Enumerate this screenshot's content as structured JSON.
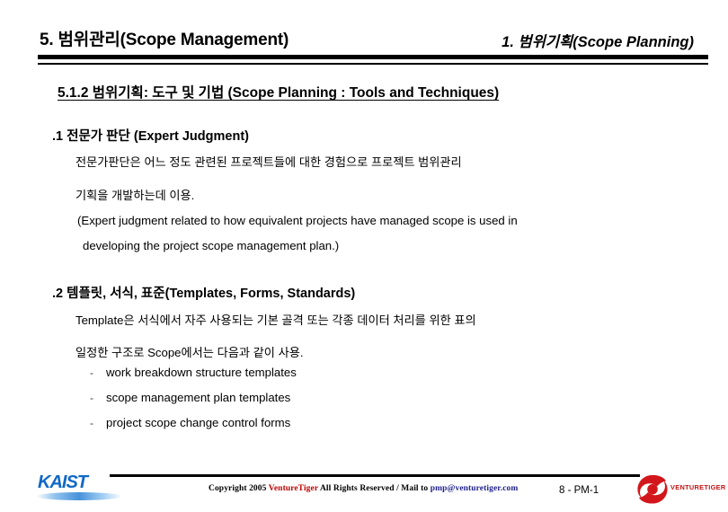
{
  "header": {
    "title_left": "5. 범위관리(Scope Management)",
    "title_right": "1. 범위기획(Scope Planning)"
  },
  "content": {
    "subtitle": "5.1.2 범위기획: 도구 및 기법 (Scope Planning : Tools and Techniques)",
    "sections": [
      {
        "heading": ".1  전문가 판단 (Expert Judgment)",
        "korean_line_1": "전문가판단은 어느 정도 관련된 프로젝트들에 대한 경험으로 프로젝트 범위관리",
        "korean_line_2": "기획을  개발하는데 이용.",
        "english_line_1": "(Expert judgment related to how equivalent projects have managed scope is used in",
        "english_line_2": "developing the project scope management plan.)"
      },
      {
        "heading": ".2 템플릿, 서식, 표준(Templates, Forms, Standards)",
        "korean_line_1": "Template은 서식에서 자주 사용되는 기본 골격 또는  각종 데이터 처리를 위한 표의",
        "korean_line_2": "일정한 구조로 Scope에서는 다음과 같이 사용.",
        "bullet_marker": "-",
        "bullets": [
          "work breakdown structure templates",
          "scope management  plan templates",
          "project scope change control forms"
        ]
      }
    ]
  },
  "footer": {
    "copyright_prefix": "Copyright 2005 ",
    "brand": "VentureTiger",
    "copyright_middle": " All Rights Reserved / Mail to ",
    "email": "pmp@venturetiger.com",
    "page_number": "8 - PM-1",
    "kaist_logo_text": "KAIST",
    "venturetiger_logo_text": "VENTURETIGER"
  },
  "colors": {
    "brand_red": "#c00000",
    "mail_blue": "#1f1f8c",
    "kaist_blue": "#1168c6",
    "logo_red": "#c41212",
    "rule_black": "#000000"
  }
}
